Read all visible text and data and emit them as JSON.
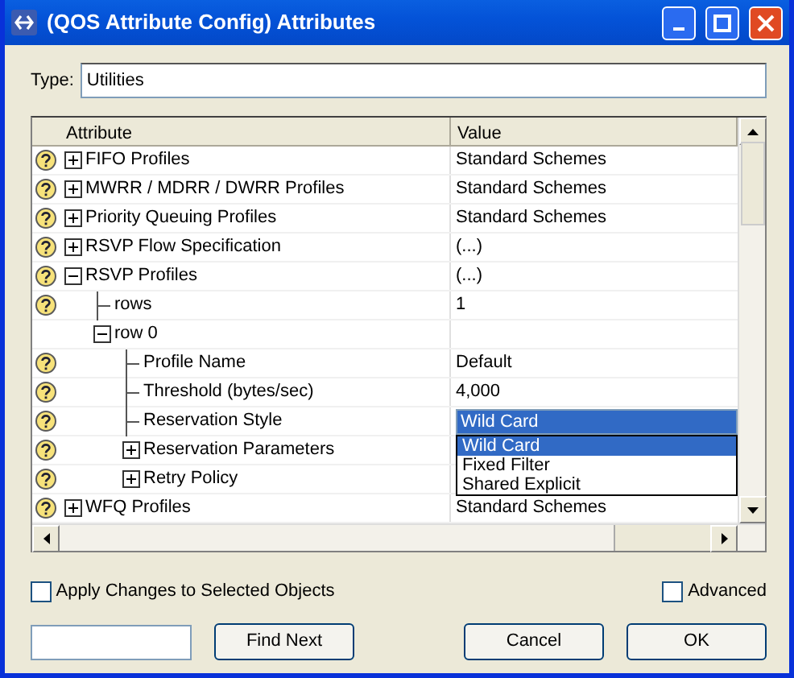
{
  "window": {
    "title": "(QOS Attribute Config) Attributes"
  },
  "type_field": {
    "label": "Type:",
    "value": "Utilities"
  },
  "table": {
    "columns": [
      "Attribute",
      "Value"
    ],
    "rows": [
      {
        "name": "FIFO Profiles",
        "value": "Standard Schemes",
        "help": true,
        "expanded": false
      },
      {
        "name": "MWRR / MDRR / DWRR Profiles",
        "value": "Standard Schemes",
        "help": true,
        "expanded": false
      },
      {
        "name": "Priority Queuing Profiles",
        "value": "Standard Schemes",
        "help": true,
        "expanded": false
      },
      {
        "name": "RSVP Flow Specification",
        "value": "(...)",
        "help": true,
        "expanded": false
      },
      {
        "name": "RSVP Profiles",
        "value": "(...)",
        "help": true,
        "expanded": true,
        "children": [
          {
            "name": "rows",
            "value": "1",
            "help": true
          },
          {
            "name": "row 0",
            "help": false,
            "expanded": true,
            "children": [
              {
                "name": "Profile Name",
                "value": "Default",
                "help": true
              },
              {
                "name": "Threshold (bytes/sec)",
                "value": "4,000",
                "help": true
              },
              {
                "name": "Reservation Style",
                "value": "Wild Card",
                "help": true,
                "dropdown": [
                  {
                    "label": "Wild Card",
                    "selected": true
                  },
                  {
                    "label": "Fixed Filter",
                    "selected": false
                  },
                  {
                    "label": "Shared Explicit",
                    "selected": false
                  }
                ]
              },
              {
                "name": "Reservation Parameters",
                "help": true,
                "expanded": false
              },
              {
                "name": "Retry Policy",
                "help": true,
                "expanded": false
              }
            ]
          }
        ]
      },
      {
        "name": "WFQ Profiles",
        "value": "Standard Schemes",
        "help": true,
        "expanded": false
      }
    ]
  },
  "apply_checkbox": {
    "label": "Apply Changes to Selected Objects",
    "checked": false
  },
  "advanced_checkbox": {
    "label": "Advanced",
    "checked": false
  },
  "buttons": [
    {
      "label": "Find Next"
    },
    {
      "label": "Cancel"
    },
    {
      "label": "OK"
    }
  ]
}
